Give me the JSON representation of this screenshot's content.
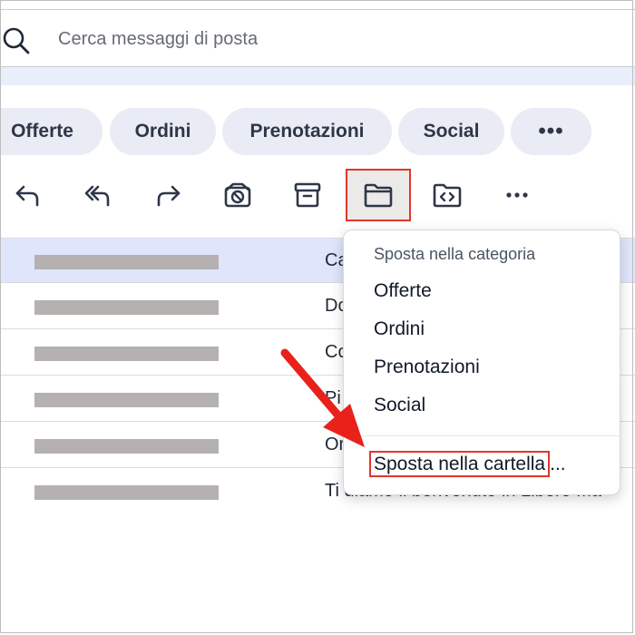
{
  "search": {
    "placeholder": "Cerca messaggi di posta",
    "icon": "search-icon"
  },
  "categories": [
    "Offerte",
    "Ordini",
    "Prenotazioni",
    "Social"
  ],
  "more_label": "•••",
  "toolbar": {
    "icons": [
      "reply-icon",
      "reply-all-icon",
      "forward-icon",
      "spam-icon",
      "archive-icon",
      "move-folder-icon",
      "category-icon",
      "more-icon"
    ],
    "more_label": "•••"
  },
  "messages": [
    {
      "subject": "Ca",
      "selected": true
    },
    {
      "subject": "Do",
      "selected": false
    },
    {
      "subject": "Co",
      "selected": false
    },
    {
      "subject": "Pi",
      "selected": false
    },
    {
      "subject": "Or",
      "selected": false
    },
    {
      "subject": "Ti diamo il benvenuto in Libero Ma",
      "selected": false
    }
  ],
  "menu": {
    "header": "Sposta nella categoria",
    "items": [
      "Offerte",
      "Ordini",
      "Prenotazioni",
      "Social"
    ],
    "folder_label": "Sposta nella cartella",
    "folder_suffix": "..."
  },
  "colors": {
    "highlight": "#e0362c",
    "selected_row": "#dfe6fb",
    "chip": "#e9ecf4",
    "arrow": "#e8221b"
  }
}
